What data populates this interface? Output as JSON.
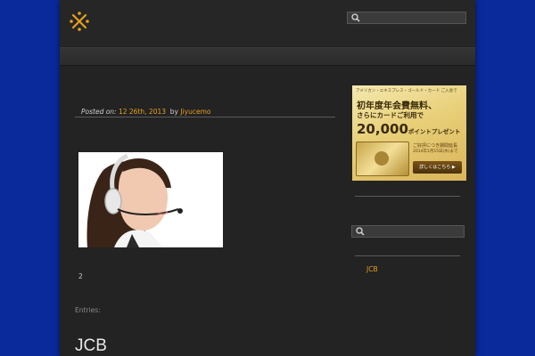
{
  "header": {
    "logo_icon": "asterisk-x-logo-icon",
    "accent_color": "#e6a020",
    "search": {
      "placeholder": "",
      "icon": "search-icon"
    }
  },
  "post": {
    "meta_prefix": "Posted on:",
    "date": "12 26th, 2013",
    "by_label": "by",
    "author": "Jiyucemo",
    "image_alt": "woman with headset",
    "body_text": "2"
  },
  "entries_label": "Entries:",
  "archive_heading": "JCB",
  "sidebar": {
    "ad": {
      "small_text": "アメリカン・エキスプレス・ゴールド・カード ご入会で",
      "headline1": "初年度年会費無料、",
      "headline2": "さらにカードご利用で",
      "amount": "20,000",
      "amount_suffix": "ポイントプレゼント",
      "note1": "ご好評につき期間延長",
      "note2": "2014年1月15日(水)まで",
      "button": "詳しくはこちら ▶"
    },
    "search": {
      "placeholder": "",
      "icon": "search-icon"
    },
    "category_link": "JCB"
  }
}
